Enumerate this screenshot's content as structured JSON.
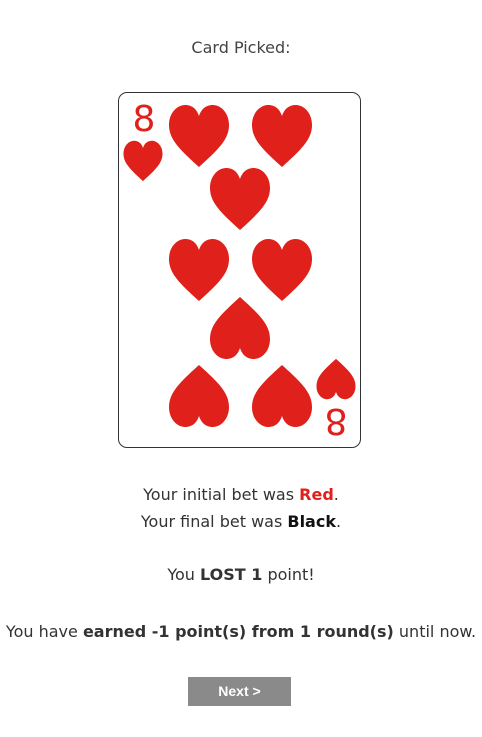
{
  "header": {
    "title": "Card Picked:"
  },
  "card": {
    "rank": "8",
    "suit": "hearts",
    "suit_icon": "heart-icon",
    "color": "#e0201b"
  },
  "bets": {
    "initial_prefix": "Your initial bet was ",
    "initial_value": "Red",
    "initial_suffix": ".",
    "final_prefix": "Your final bet was ",
    "final_value": "Black",
    "final_suffix": "."
  },
  "result": {
    "prefix": "You ",
    "outcome": "LOST 1",
    "suffix": " point!"
  },
  "summary": {
    "prefix": "You have ",
    "earned": "earned -1 point(s) from 1 round(s)",
    "suffix": " until now."
  },
  "buttons": {
    "next_label": "Next >"
  }
}
